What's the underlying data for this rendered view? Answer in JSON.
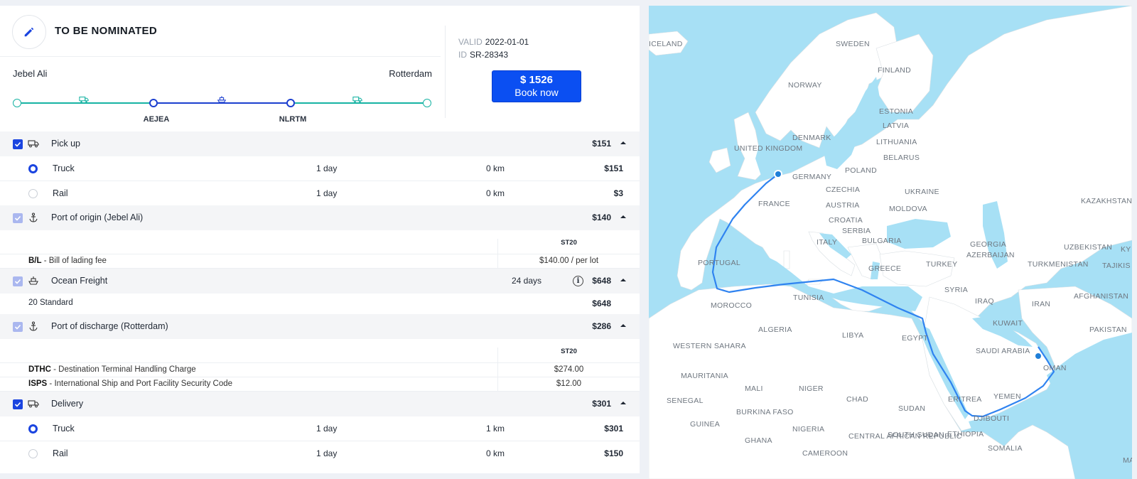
{
  "header": {
    "title": "TO BE NOMINATED",
    "valid_label": "VALID",
    "valid_value": "2022-01-01",
    "id_label": "ID",
    "id_value": "SR-28343",
    "book_price": "$ 1526",
    "book_label": "Book now"
  },
  "route": {
    "origin": "Jebel Ali",
    "destination": "Rotterdam",
    "origin_port_code": "AEJEA",
    "dest_port_code": "NLRTM"
  },
  "sections": {
    "pickup": {
      "title": "Pick up",
      "price": "$151",
      "options": [
        {
          "name": "Truck",
          "days": "1 day",
          "km": "0 km",
          "price": "$151"
        },
        {
          "name": "Rail",
          "days": "1 day",
          "km": "0 km",
          "price": "$3"
        }
      ]
    },
    "port_origin": {
      "title": "Port of origin (Jebel Ali)",
      "price": "$140",
      "column": "ST20",
      "fees": [
        {
          "code": "B/L",
          "desc": " - Bill of lading fee",
          "value": "$140.00 / per lot"
        }
      ]
    },
    "ocean": {
      "title": "Ocean Freight",
      "days": "24 days",
      "info": "i",
      "price": "$648",
      "std_name": "20 Standard",
      "std_price": "$648"
    },
    "port_discharge": {
      "title": "Port of discharge (Rotterdam)",
      "price": "$286",
      "column": "ST20",
      "fees": [
        {
          "code": "DTHC",
          "desc": " - Destination Terminal Handling Charge",
          "value": "$274.00"
        },
        {
          "code": "ISPS",
          "desc": " - International Ship and Port Facility Security Code",
          "value": "$12.00"
        }
      ]
    },
    "delivery": {
      "title": "Delivery",
      "price": "$301",
      "options": [
        {
          "name": "Truck",
          "days": "1 day",
          "km": "1 km",
          "price": "$301"
        },
        {
          "name": "Rail",
          "days": "1 day",
          "km": "0 km",
          "price": "$150"
        }
      ]
    }
  },
  "map": {
    "labels": [
      "ICELAND",
      "SWEDEN",
      "FINLAND",
      "NORWAY",
      "ESTONIA",
      "LATVIA",
      "LITHUANIA",
      "DENMARK",
      "UNITED KINGDOM",
      "BELARUS",
      "GERMANY",
      "POLAND",
      "CZECHIA",
      "UKRAINE",
      "FRANCE",
      "AUSTRIA",
      "MOLDOVA",
      "KAZAKHSTAN",
      "CROATIA",
      "SERBIA",
      "BULGARIA",
      "ITALY",
      "GEORGIA",
      "UZBEKISTAN",
      "KY",
      "AZERBAIJAN",
      "PORTUGAL",
      "GREECE",
      "TURKEY",
      "TURKMENISTAN",
      "TAJIKIS",
      "TUNISIA",
      "SYRIA",
      "AFGHANISTAN",
      "MOROCCO",
      "IRAQ",
      "IRAN",
      "ALGERIA",
      "LIBYA",
      "KUWAIT",
      "PAKISTAN",
      "EGYPT",
      "WESTERN SAHARA",
      "SAUDI ARABIA",
      "OMAN",
      "MAURITANIA",
      "MALI",
      "NIGER",
      "YEMEN",
      "SENEGAL",
      "CHAD",
      "SUDAN",
      "ERITREA",
      "BURKINA FASO",
      "GUINEA",
      "DJIBOUTI",
      "NIGERIA",
      "ETHIOPIA",
      "GHANA",
      "CENTRAL AFRICAN REPUBLIC",
      "SOUTH SUDAN",
      "SOMALIA",
      "CAMEROON",
      "MA"
    ],
    "water_color": "#a7e0f5",
    "land_color": "#ffffff",
    "route_color": "#2f83f0"
  }
}
